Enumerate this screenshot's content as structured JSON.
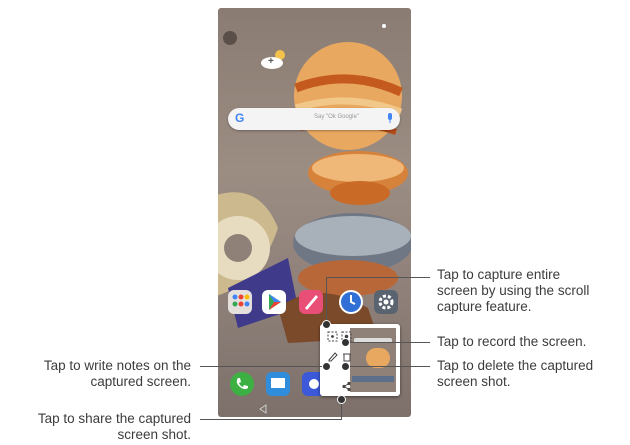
{
  "search_bar": {
    "logo": "G",
    "hint": "Say \"Ok Google\""
  },
  "weather": {
    "temperature": "+",
    "icon": "partly-sunny-icon"
  },
  "apps": [
    {
      "label": "Google",
      "icon": "google-folder-icon"
    },
    {
      "label": "Play Store",
      "icon": "play-store-icon"
    },
    {
      "label": "",
      "icon": "pen-app-icon"
    },
    {
      "label": "",
      "icon": "clock-app-icon"
    },
    {
      "label": "",
      "icon": "settings-gear-icon"
    }
  ],
  "callouts": {
    "capture_entire": "Tap to capture entire\nscreen by using the scroll\ncapture feature.",
    "record": "Tap to record the screen.",
    "delete": "Tap to delete the captured\nscreen shot.",
    "write_notes": "Tap to write notes on the\ncaptured screen.",
    "share": "Tap to share the captured\nscreen shot."
  },
  "colors": {
    "wallpaper": "#8f8178",
    "accent_orange": "#e07a30",
    "phone_app_green": "#3cb043",
    "toolbar_bg": "#ffffff"
  }
}
